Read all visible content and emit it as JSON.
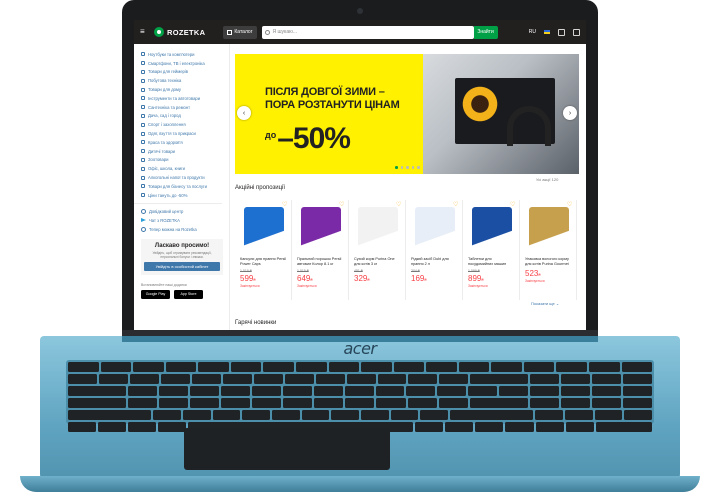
{
  "brand": {
    "laptop_logo": "acer"
  },
  "header": {
    "logo_text": "ROZETKA",
    "catalog_label": "Каталог",
    "search_placeholder": "Я шукаю...",
    "search_button": "Знайти",
    "language": "RU"
  },
  "sidebar": {
    "categories": [
      "Ноутбуки та комп'ютери",
      "Смартфони, ТВ і електроніка",
      "Товари для геймерів",
      "Побутова техніка",
      "Товари для дому",
      "Інструменти та автотовари",
      "Сантехніка та ремонт",
      "Дача, сад і город",
      "Спорт і захоплення",
      "Одяг, взуття та прикраси",
      "Краса та здоров'я",
      "Дитячі товари",
      "Зоотовари",
      "Офіс, школа, книги",
      "Алкогольні напої та продукти",
      "Товари для бізнесу та послуги",
      "Ціни тануть до -50%"
    ],
    "links": [
      "Довідковий центр",
      "Чат з ROZETKA",
      "Тепер можна на Rozetka"
    ],
    "welcome": {
      "title": "Ласкаво просимо!",
      "text": "Увійдіть, щоб отримувати рекомендації, персональні бонуси і знижки.",
      "button": "Увійдіть в особистий кабінет"
    },
    "apps_caption": "Встановлюйте наші додатки",
    "stores": [
      "Google Play",
      "App Store"
    ]
  },
  "banner": {
    "line1": "ПІСЛЯ ДОВГОЇ ЗИМИ –",
    "line2": "ПОРА РОЗТАНУТИ ЦІНАМ",
    "prefix": "до",
    "discount": "–50%",
    "all_promos": "Усі акції  120"
  },
  "offers": {
    "title": "Акційні пропозиції",
    "products": [
      {
        "name": "Капсули для прання Persil Power Caps",
        "old_price": "1 019 ₴",
        "price": "599",
        "status": "Закінчується",
        "color": "#1d6fd0"
      },
      {
        "name": "Пральний порошок Persil автомат Колор 8.1 кг",
        "old_price": "1 019 ₴",
        "price": "649",
        "status": "Закінчується",
        "color": "#7b2aa7"
      },
      {
        "name": "Сухий корм Purina One для котів 3 кг",
        "old_price": "451 ₴",
        "price": "329",
        "status": "",
        "color": "#f2f2f2"
      },
      {
        "name": "Рідкий засіб Dubi для прання 2 л",
        "old_price": "204 ₴",
        "price": "169",
        "status": "",
        "color": "#e7eef7"
      },
      {
        "name": "Таблетки для посудомийних машин",
        "old_price": "1 099 ₴",
        "price": "899",
        "status": "Закінчується",
        "color": "#1b4fa3"
      },
      {
        "name": "Упаковка вологого корму для котів Purina Gourmet",
        "old_price": "",
        "price": "523",
        "status": "Закінчується",
        "color": "#c6a04d"
      }
    ],
    "currency": "₴",
    "show_more": "Показати ще ⌄"
  },
  "next_section": {
    "title": "Гарячі новинки"
  }
}
